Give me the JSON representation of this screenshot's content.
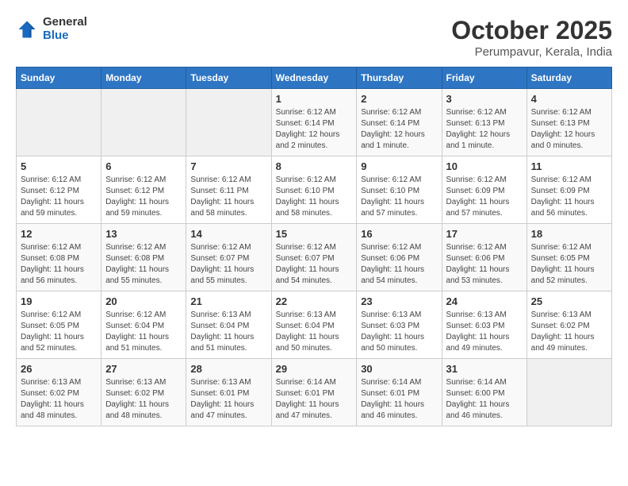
{
  "header": {
    "logo_general": "General",
    "logo_blue": "Blue",
    "title": "October 2025",
    "location": "Perumpavur, Kerala, India"
  },
  "weekdays": [
    "Sunday",
    "Monday",
    "Tuesday",
    "Wednesday",
    "Thursday",
    "Friday",
    "Saturday"
  ],
  "weeks": [
    [
      {
        "day": "",
        "info": ""
      },
      {
        "day": "",
        "info": ""
      },
      {
        "day": "",
        "info": ""
      },
      {
        "day": "1",
        "info": "Sunrise: 6:12 AM\nSunset: 6:14 PM\nDaylight: 12 hours\nand 2 minutes."
      },
      {
        "day": "2",
        "info": "Sunrise: 6:12 AM\nSunset: 6:14 PM\nDaylight: 12 hours\nand 1 minute."
      },
      {
        "day": "3",
        "info": "Sunrise: 6:12 AM\nSunset: 6:13 PM\nDaylight: 12 hours\nand 1 minute."
      },
      {
        "day": "4",
        "info": "Sunrise: 6:12 AM\nSunset: 6:13 PM\nDaylight: 12 hours\nand 0 minutes."
      }
    ],
    [
      {
        "day": "5",
        "info": "Sunrise: 6:12 AM\nSunset: 6:12 PM\nDaylight: 11 hours\nand 59 minutes."
      },
      {
        "day": "6",
        "info": "Sunrise: 6:12 AM\nSunset: 6:12 PM\nDaylight: 11 hours\nand 59 minutes."
      },
      {
        "day": "7",
        "info": "Sunrise: 6:12 AM\nSunset: 6:11 PM\nDaylight: 11 hours\nand 58 minutes."
      },
      {
        "day": "8",
        "info": "Sunrise: 6:12 AM\nSunset: 6:10 PM\nDaylight: 11 hours\nand 58 minutes."
      },
      {
        "day": "9",
        "info": "Sunrise: 6:12 AM\nSunset: 6:10 PM\nDaylight: 11 hours\nand 57 minutes."
      },
      {
        "day": "10",
        "info": "Sunrise: 6:12 AM\nSunset: 6:09 PM\nDaylight: 11 hours\nand 57 minutes."
      },
      {
        "day": "11",
        "info": "Sunrise: 6:12 AM\nSunset: 6:09 PM\nDaylight: 11 hours\nand 56 minutes."
      }
    ],
    [
      {
        "day": "12",
        "info": "Sunrise: 6:12 AM\nSunset: 6:08 PM\nDaylight: 11 hours\nand 56 minutes."
      },
      {
        "day": "13",
        "info": "Sunrise: 6:12 AM\nSunset: 6:08 PM\nDaylight: 11 hours\nand 55 minutes."
      },
      {
        "day": "14",
        "info": "Sunrise: 6:12 AM\nSunset: 6:07 PM\nDaylight: 11 hours\nand 55 minutes."
      },
      {
        "day": "15",
        "info": "Sunrise: 6:12 AM\nSunset: 6:07 PM\nDaylight: 11 hours\nand 54 minutes."
      },
      {
        "day": "16",
        "info": "Sunrise: 6:12 AM\nSunset: 6:06 PM\nDaylight: 11 hours\nand 54 minutes."
      },
      {
        "day": "17",
        "info": "Sunrise: 6:12 AM\nSunset: 6:06 PM\nDaylight: 11 hours\nand 53 minutes."
      },
      {
        "day": "18",
        "info": "Sunrise: 6:12 AM\nSunset: 6:05 PM\nDaylight: 11 hours\nand 52 minutes."
      }
    ],
    [
      {
        "day": "19",
        "info": "Sunrise: 6:12 AM\nSunset: 6:05 PM\nDaylight: 11 hours\nand 52 minutes."
      },
      {
        "day": "20",
        "info": "Sunrise: 6:12 AM\nSunset: 6:04 PM\nDaylight: 11 hours\nand 51 minutes."
      },
      {
        "day": "21",
        "info": "Sunrise: 6:13 AM\nSunset: 6:04 PM\nDaylight: 11 hours\nand 51 minutes."
      },
      {
        "day": "22",
        "info": "Sunrise: 6:13 AM\nSunset: 6:04 PM\nDaylight: 11 hours\nand 50 minutes."
      },
      {
        "day": "23",
        "info": "Sunrise: 6:13 AM\nSunset: 6:03 PM\nDaylight: 11 hours\nand 50 minutes."
      },
      {
        "day": "24",
        "info": "Sunrise: 6:13 AM\nSunset: 6:03 PM\nDaylight: 11 hours\nand 49 minutes."
      },
      {
        "day": "25",
        "info": "Sunrise: 6:13 AM\nSunset: 6:02 PM\nDaylight: 11 hours\nand 49 minutes."
      }
    ],
    [
      {
        "day": "26",
        "info": "Sunrise: 6:13 AM\nSunset: 6:02 PM\nDaylight: 11 hours\nand 48 minutes."
      },
      {
        "day": "27",
        "info": "Sunrise: 6:13 AM\nSunset: 6:02 PM\nDaylight: 11 hours\nand 48 minutes."
      },
      {
        "day": "28",
        "info": "Sunrise: 6:13 AM\nSunset: 6:01 PM\nDaylight: 11 hours\nand 47 minutes."
      },
      {
        "day": "29",
        "info": "Sunrise: 6:14 AM\nSunset: 6:01 PM\nDaylight: 11 hours\nand 47 minutes."
      },
      {
        "day": "30",
        "info": "Sunrise: 6:14 AM\nSunset: 6:01 PM\nDaylight: 11 hours\nand 46 minutes."
      },
      {
        "day": "31",
        "info": "Sunrise: 6:14 AM\nSunset: 6:00 PM\nDaylight: 11 hours\nand 46 minutes."
      },
      {
        "day": "",
        "info": ""
      }
    ]
  ]
}
